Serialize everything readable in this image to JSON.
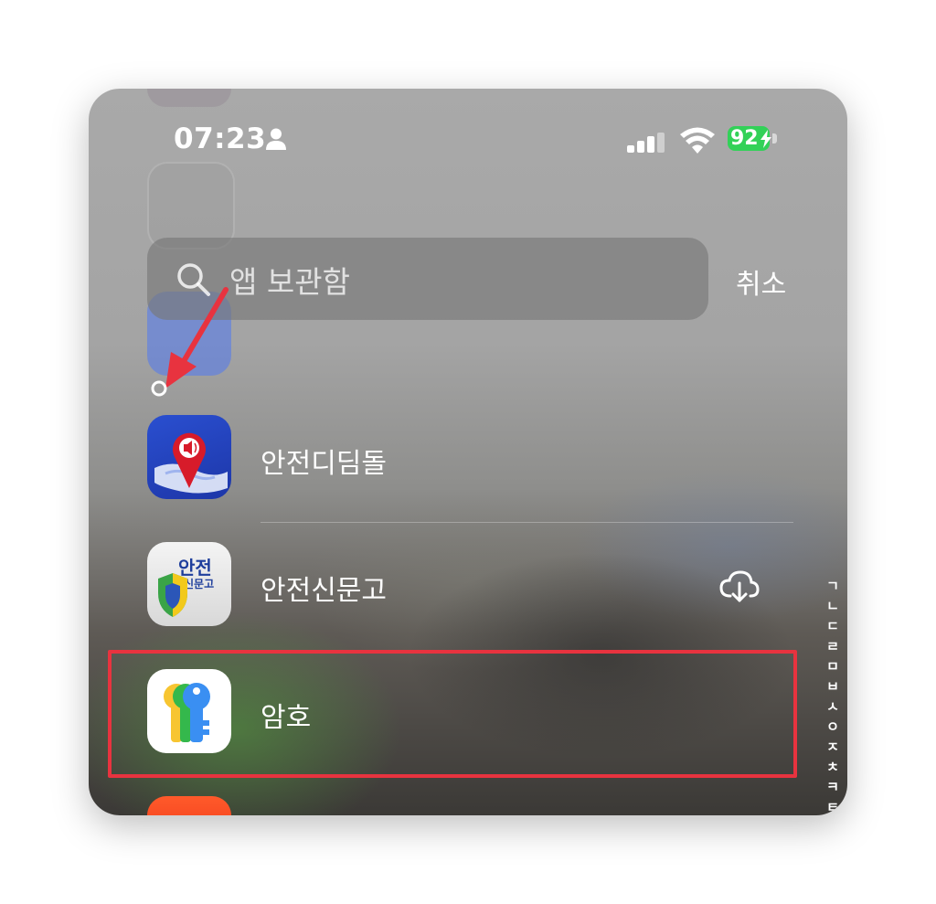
{
  "status_bar": {
    "time": "07:23",
    "battery": "92"
  },
  "search": {
    "placeholder": "앱 보관함",
    "cancel_label": "취소"
  },
  "apps": [
    {
      "label": "안전디딤돌",
      "icon": "safety-stepping-stone-app-icon"
    },
    {
      "label": "안전신문고",
      "icon": "safety-report-app-icon",
      "icon_text_top": "안전",
      "icon_text_bottom": "신문고",
      "download": "cloud-download-icon"
    },
    {
      "label": "암호",
      "icon": "passwords-app-icon",
      "highlighted": true
    }
  ],
  "index_letters": [
    "ㄱ",
    "ㄴ",
    "ㄷ",
    "ㄹ",
    "ㅁ",
    "ㅂ",
    "ㅅ",
    "ㅇ",
    "ㅈ",
    "ㅊ",
    "ㅋ",
    "ㅌ"
  ],
  "colors": {
    "highlight_border": "#e8333f",
    "annotation_arrow": "#e8333f",
    "battery": "#32d158"
  }
}
